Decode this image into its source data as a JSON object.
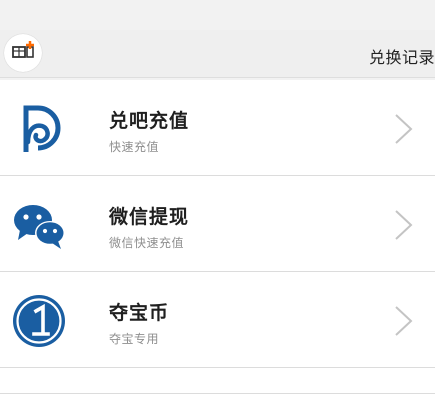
{
  "header": {
    "title": "兑换记录"
  },
  "icons": {
    "back": "back-icon",
    "chevron": "chevron-right-icon",
    "duiba": "duiba-logo-icon",
    "wechat": "wechat-icon",
    "duobao": "coin-number-one-icon"
  },
  "colors": {
    "brand_blue": "#1a5ea2",
    "accent_orange": "#ff6a00"
  },
  "options": [
    {
      "title": "兑吧充值",
      "subtitle": "快速充值"
    },
    {
      "title": "微信提现",
      "subtitle": "微信快速充值"
    },
    {
      "title": "夺宝币",
      "subtitle": "夺宝专用"
    }
  ]
}
